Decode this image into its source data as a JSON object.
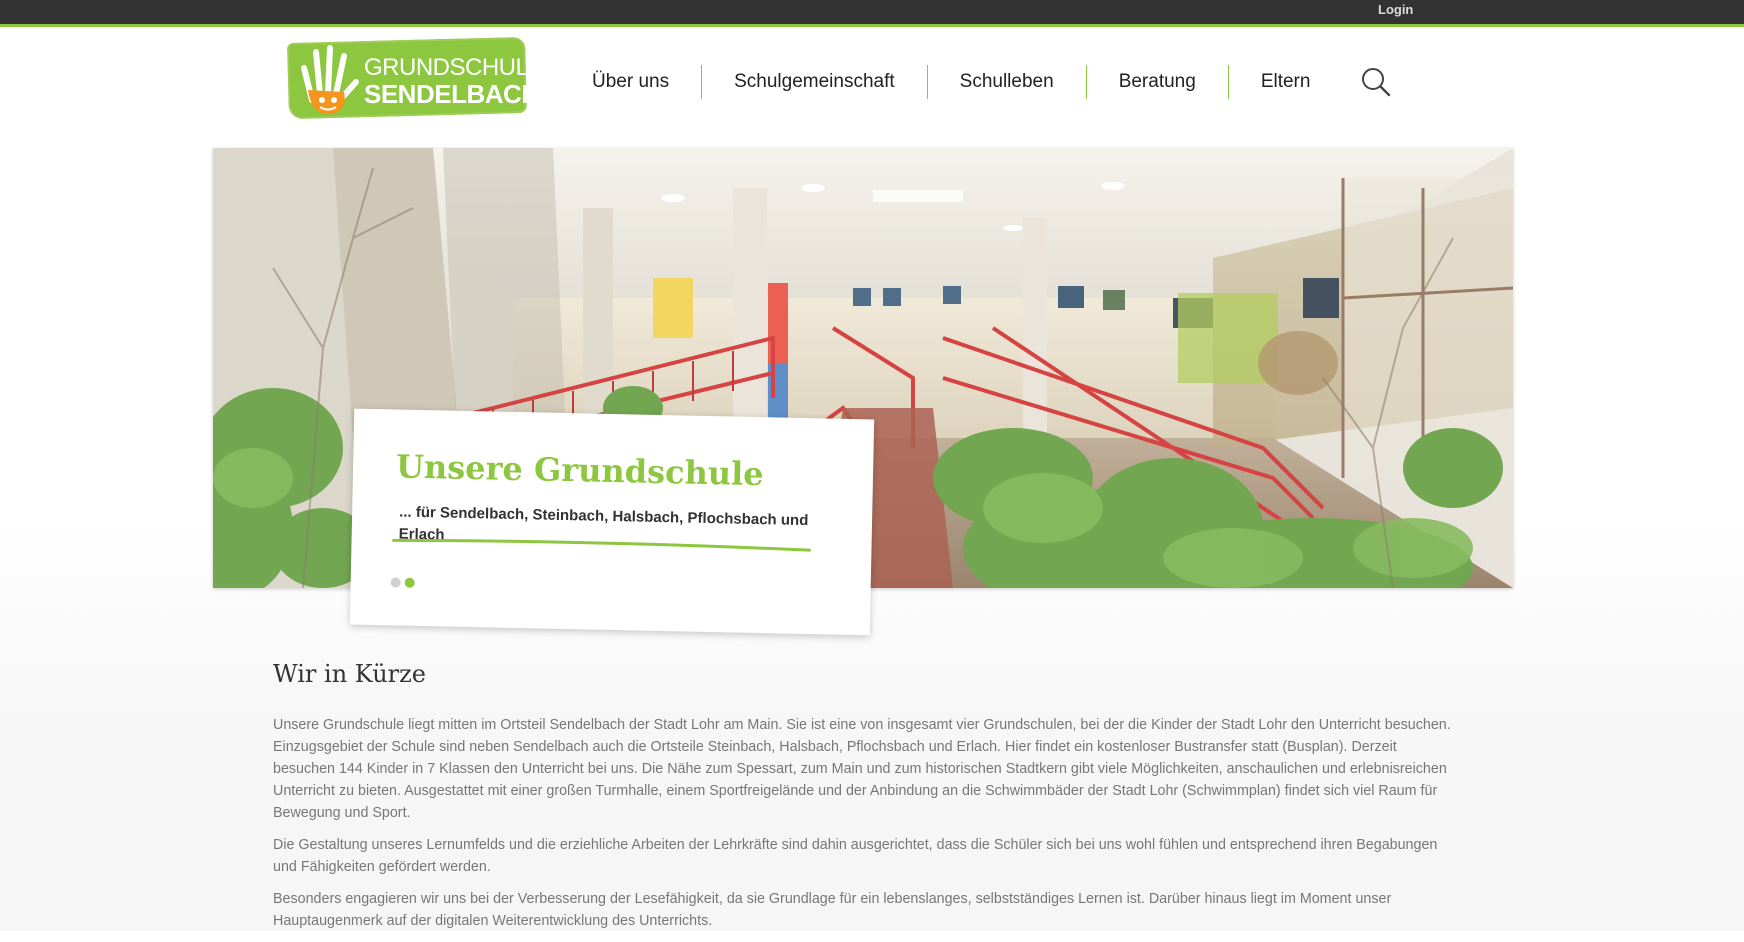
{
  "topbar": {
    "login_label": "Login"
  },
  "logo": {
    "line1": "GRUNDSCHULE",
    "line2": "SENDELBACH"
  },
  "nav": {
    "items": [
      {
        "label": "Über uns"
      },
      {
        "label": "Schulgemeinschaft"
      },
      {
        "label": "Schulleben"
      },
      {
        "label": "Beratung"
      },
      {
        "label": "Eltern"
      }
    ],
    "search_icon": "search-icon"
  },
  "hero": {
    "title": "Unsere Grundschule",
    "subtitle": "... für Sendelbach, Steinbach, Halsbach, Pflochsbach und Erlach",
    "slide_count": 2,
    "active_slide": 2
  },
  "content": {
    "heading": "Wir in Kürze",
    "paragraphs": [
      "Unsere Grundschule liegt mitten im Ortsteil Sendelbach der Stadt Lohr am Main. Sie ist eine von insgesamt vier Grundschulen, bei der die Kinder der Stadt Lohr den Unterricht besuchen. Einzugsgebiet der Schule sind neben Sendelbach auch die Ortsteile Steinbach, Halsbach, Pflochsbach und Erlach. Hier findet ein kostenloser Bustransfer statt (Busplan). Derzeit besuchen 144 Kinder in 7 Klassen den Unterricht bei uns. Die Nähe zum Spessart, zum Main und zum historischen Stadtkern gibt viele Möglichkeiten, anschaulichen und erlebnisreichen Unterricht zu bieten. Ausgestattet mit einer großen Turmhalle, einem Sportfreigelände und der Anbindung an die Schwimmbäder der Stadt Lohr (Schwimmplan) findet sich viel Raum für Bewegung und Sport.",
      "Die Gestaltung unseres Lernumfelds und die erziehliche Arbeiten der Lehrkräfte sind dahin ausgerichtet, dass die Schüler sich bei uns wohl fühlen und entsprechend ihren Begabungen und Fähigkeiten gefördert werden.",
      "Besonders engagieren wir uns bei der Verbesserung der Lesefähigkeit, da sie Grundlage für ein lebenslanges, selbstständiges Lernen ist. Darüber hinaus liegt im Moment unser Hauptaugenmerk auf der digitalen Weiterentwicklung des Unterrichts."
    ]
  },
  "colors": {
    "accent": "#8dc63f",
    "topbar": "#333333",
    "text": "#777777"
  }
}
